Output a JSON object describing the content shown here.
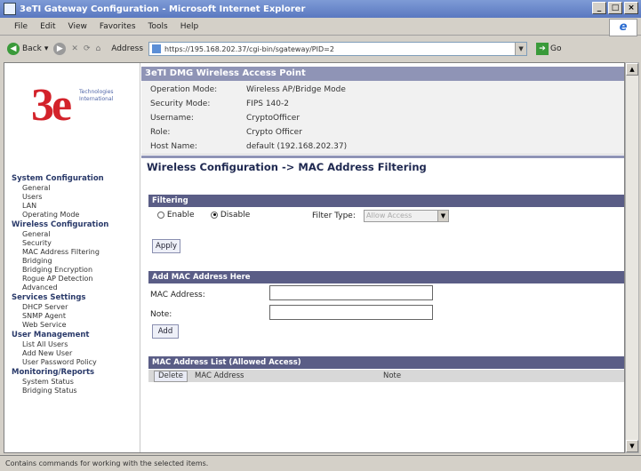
{
  "window": {
    "title": "3eTI Gateway Configuration - Microsoft Internet Explorer",
    "minimize": "_",
    "maximize": "□",
    "close": "×"
  },
  "menu": [
    "File",
    "Edit",
    "View",
    "Favorites",
    "Tools",
    "Help"
  ],
  "toolbar": {
    "back_label": "Back",
    "address_label": "Address",
    "url": "https://195.168.202.37/cgi-bin/sgateway/PID=2",
    "go_label": "Go"
  },
  "logo": {
    "mark": "3e",
    "tagline_1": "Technologies",
    "tagline_2": "International"
  },
  "nav": [
    {
      "section": "System Configuration",
      "items": [
        "General",
        "Users",
        "LAN",
        "Operating Mode"
      ]
    },
    {
      "section": "Wireless Configuration",
      "items": [
        "General",
        "Security",
        "MAC Address Filtering",
        "Bridging",
        "Bridging Encryption",
        "Rogue AP Detection",
        "Advanced"
      ]
    },
    {
      "section": "Services Settings",
      "items": [
        "DHCP Server",
        "SNMP Agent",
        "Web Service"
      ]
    },
    {
      "section": "User Management",
      "items": [
        "List All Users",
        "Add New User",
        "User Password Policy"
      ]
    },
    {
      "section": "Monitoring/Reports",
      "items": [
        "System Status",
        "Bridging Status"
      ]
    }
  ],
  "info": {
    "title": "3eTI DMG Wireless Access Point",
    "rows": [
      {
        "key": "Operation Mode:",
        "value": "Wireless AP/Bridge Mode"
      },
      {
        "key": "Security Mode:",
        "value": "FIPS 140-2"
      },
      {
        "key": "Username:",
        "value": "CryptoOfficer"
      },
      {
        "key": "Role:",
        "value": "Crypto Officer"
      },
      {
        "key": "Host Name:",
        "value": "default (192.168.202.37)"
      }
    ]
  },
  "page_heading": "Wireless Configuration -> MAC Address Filtering",
  "filtering": {
    "title": "Filtering",
    "enable_label": "Enable",
    "disable_label": "Disable",
    "selected": "Disable",
    "filter_type_label": "Filter Type:",
    "filter_type_value": "Allow Access",
    "apply_label": "Apply"
  },
  "add_form": {
    "title": "Add MAC Address Here",
    "mac_label": "MAC Address:",
    "note_label": "Note:",
    "mac_value": "",
    "note_value": "",
    "add_label": "Add"
  },
  "mac_list": {
    "title": "MAC Address List (Allowed Access)",
    "columns": [
      "Delete",
      "MAC Address",
      "Note"
    ]
  },
  "status": {
    "text": "Contains commands for working with the selected items."
  }
}
